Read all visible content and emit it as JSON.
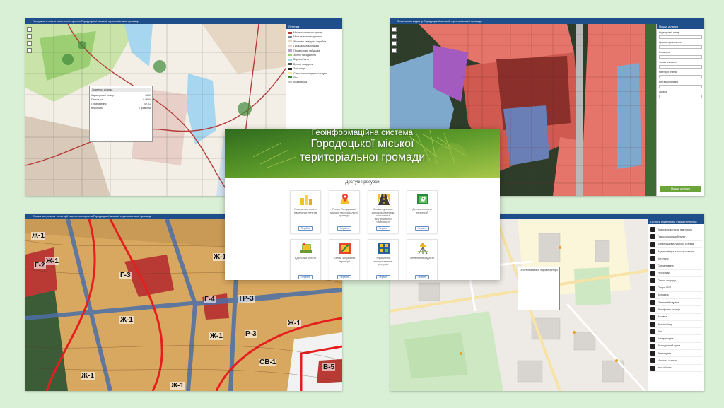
{
  "screens": {
    "top_left": {
      "title": "Генеральні плани населених пунктів Городоцької міської територіальної громади",
      "legend_title": "Легенда",
      "legend_items": [
        "Межа населеного пункту",
        "Межі земельних ділянок",
        "Житлова забудова садибна",
        "Громадська забудова",
        "Промислова забудова",
        "Зелені насадження",
        "Водні об'єкти",
        "Вулиці та дороги",
        "Залізниця",
        "Сільськогосподарські угіддя",
        "Ліси",
        "Кладовища"
      ],
      "popup_title": "Земельна ділянка",
      "popup_rows": [
        [
          "Кадастровий номер",
          "4620"
        ],
        [
          "Площа, га",
          "0.0810"
        ],
        [
          "Призначення",
          "02.01"
        ],
        [
          "Власність",
          "Приватна"
        ]
      ]
    },
    "top_right": {
      "title": "Земельний кадастр Городоцької міської територіальної громади",
      "panel_title": "Пошук ділянки",
      "panel_fields": [
        "Кадастровий номер",
        "Цільове призначення",
        "Площа, га",
        "Форма власності",
        "Категорія земель",
        "Вид використання",
        "Адреса"
      ],
      "panel_button": "Пошук ділянки"
    },
    "bottom_left": {
      "title": "Схема зонування території населених пунктів Городоцької міської територіальної громади",
      "zone_labels": [
        "Ж-1",
        "Ж-1",
        "Г-2",
        "Г-3",
        "Ж-1",
        "Г-4",
        "ТР-3",
        "Ж-1",
        "Р-3",
        "Ж-1",
        "Ж-1",
        "СВ-1",
        "В-5",
        "Ж-1",
        "Ж-1"
      ]
    },
    "bottom_right": {
      "title": "",
      "legend_title": "Об'єкти інженерної інфраструктури",
      "legend_items": [
        "Трансформаторна підстанція",
        "Газорозподільний пункт",
        "Каналізаційна насосна станція",
        "Водопровідна насосна станція",
        "Котельня",
        "Свердловина",
        "Резервуар",
        "Очисні споруди",
        "Опора ЛЕП",
        "Колодязь",
        "Пожежний гідрант",
        "Телефонна станція",
        "Засувка",
        "Вузол обліку",
        "Люк",
        "Компресорна",
        "Розподільчий пункт",
        "Теплопункт",
        "Насосна станція",
        "Інші об'єкти"
      ],
      "popup_title": "Об'єкт інженерної інфраструктури"
    }
  },
  "portal": {
    "sup_title": "Геоінформаційна система",
    "title_line1": "Городоцької міської",
    "title_line2": "територіальної громади",
    "resources_title": "Доступні ресурси",
    "open_label": "Перейти",
    "cards": [
      {
        "label": "Генеральні плани населених пунктів",
        "icon": "buildings-icon"
      },
      {
        "label": "Плани Городоцької міської територіальної громади",
        "icon": "map-pin-icon"
      },
      {
        "label": "Схема вулично-дорожньої мережі, міського та внутрішнього транспорту",
        "icon": "road-icon"
      },
      {
        "label": "Детальні плани територій",
        "icon": "detail-plan-icon"
      },
      {
        "label": "Адресний реєстр",
        "icon": "address-register-icon"
      },
      {
        "label": "Схеми зонування території",
        "icon": "zoning-icon"
      },
      {
        "label": "Управління використанням ресурсів",
        "icon": "resources-icon"
      },
      {
        "label": "Земельний кадастр",
        "icon": "surveyor-icon"
      }
    ]
  },
  "colors": {
    "background": "#d9efd6",
    "header": "#1f4f8a",
    "accent_green": "#6ba43a",
    "button_border": "#6a8fc4"
  }
}
